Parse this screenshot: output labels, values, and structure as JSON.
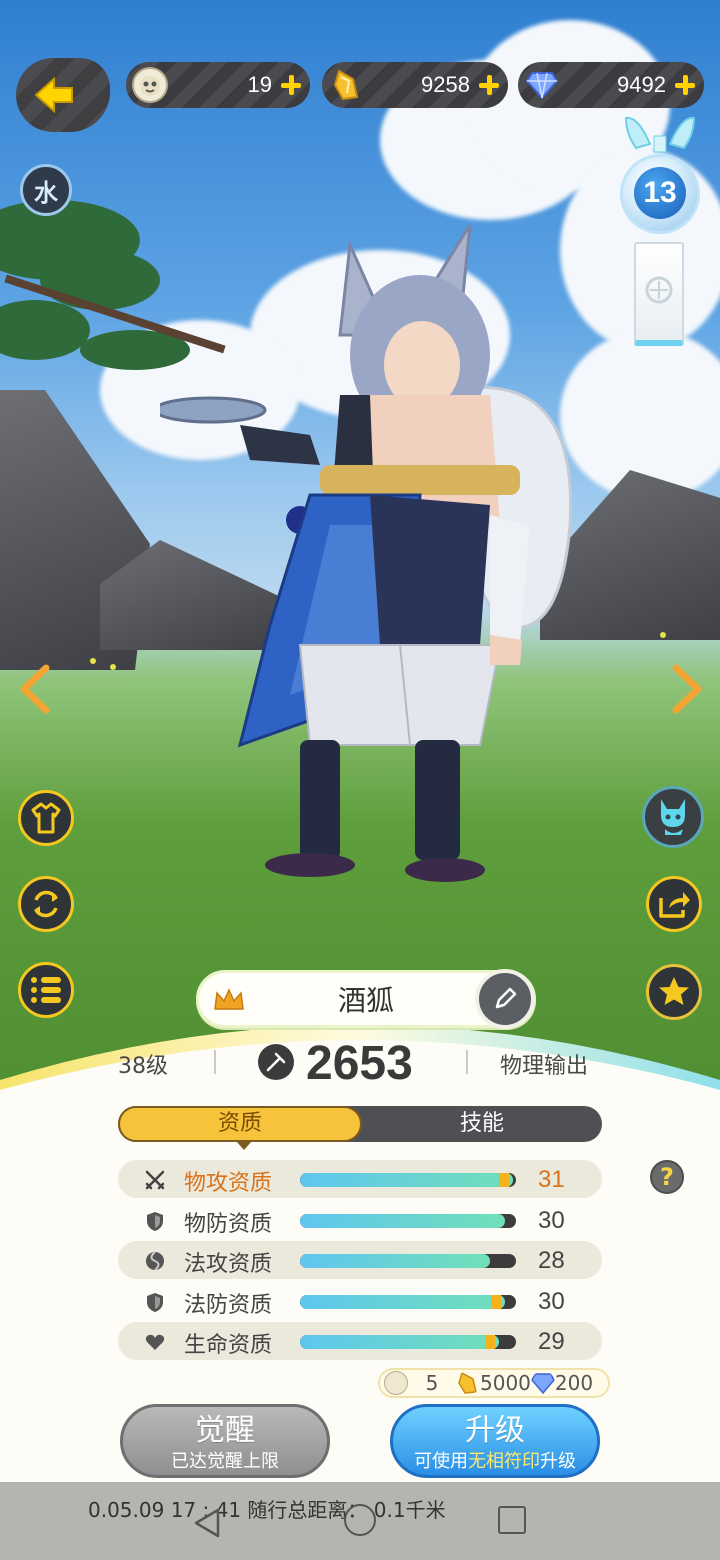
{
  "topbar": {
    "currencies": [
      {
        "icon": "beast-face-icon",
        "value": "19"
      },
      {
        "icon": "gold-shard-icon",
        "value": "9258"
      },
      {
        "icon": "diamond-icon",
        "value": "9492"
      }
    ]
  },
  "element_badge": "水",
  "level_orb": "13",
  "hero": {
    "name": "酒狐",
    "level": "38级",
    "power": "2653",
    "role": "物理输出"
  },
  "tabs": [
    {
      "label": "资质",
      "active": true
    },
    {
      "label": "技能",
      "active": false
    }
  ],
  "stats": [
    {
      "name": "物攻资质",
      "value": "31",
      "icon": "crossed-swords-icon",
      "fill": 0.985,
      "tip": true,
      "highlight": true
    },
    {
      "name": "物防资质",
      "value": "30",
      "icon": "shield-icon",
      "fill": 0.95,
      "tip": false,
      "highlight": false
    },
    {
      "name": "法攻资质",
      "value": "28",
      "icon": "orb-icon",
      "fill": 0.88,
      "tip": false,
      "highlight": false
    },
    {
      "name": "法防资质",
      "value": "30",
      "icon": "shield-icon",
      "fill": 0.95,
      "tip": true,
      "highlight": false
    },
    {
      "name": "生命资质",
      "value": "29",
      "icon": "heart-icon",
      "fill": 0.92,
      "tip": true,
      "highlight": false
    }
  ],
  "help_label": "?",
  "cost": {
    "token": "5",
    "gold": "5000",
    "diamond": "200"
  },
  "buttons": {
    "awaken": {
      "title": "觉醒",
      "sub": "已达觉醒上限"
    },
    "upgrade": {
      "title": "升级",
      "sub_pre": "可使用",
      "sub_hl": "无相符印",
      "sub_post": "升级"
    }
  },
  "watermark": "0.05.09   17 : 41   随行总距离：  0.1千米",
  "colors": {
    "accent_gold": "#f7c33b",
    "highlight_orange": "#d9731a",
    "bar_fill": "#5fc6ef",
    "upgrade_blue": "#2a8fe6"
  }
}
